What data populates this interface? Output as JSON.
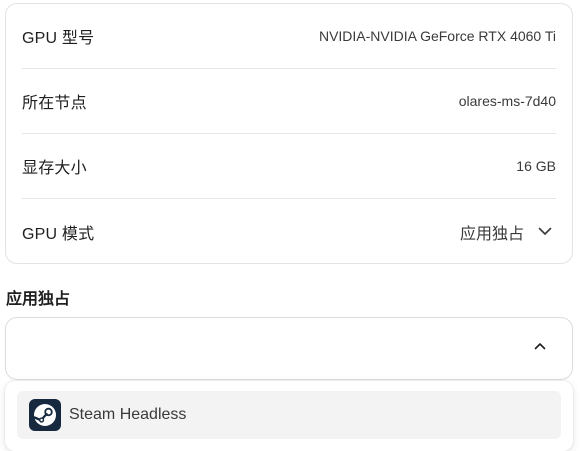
{
  "gpu_info": {
    "rows": [
      {
        "label": "GPU 型号",
        "value": "NVIDIA-NVIDIA GeForce RTX 4060 Ti"
      },
      {
        "label": "所在节点",
        "value": "olares-ms-7d40"
      },
      {
        "label": "显存大小",
        "value": "16 GB"
      }
    ],
    "mode": {
      "label": "GPU 模式",
      "value": "应用独占",
      "icon": "chevron-down-icon"
    }
  },
  "exclusive_app": {
    "title": "应用独占",
    "select_value": "",
    "expanded": true,
    "options": [
      {
        "label": "Steam Headless",
        "icon": "steam-icon"
      }
    ]
  }
}
